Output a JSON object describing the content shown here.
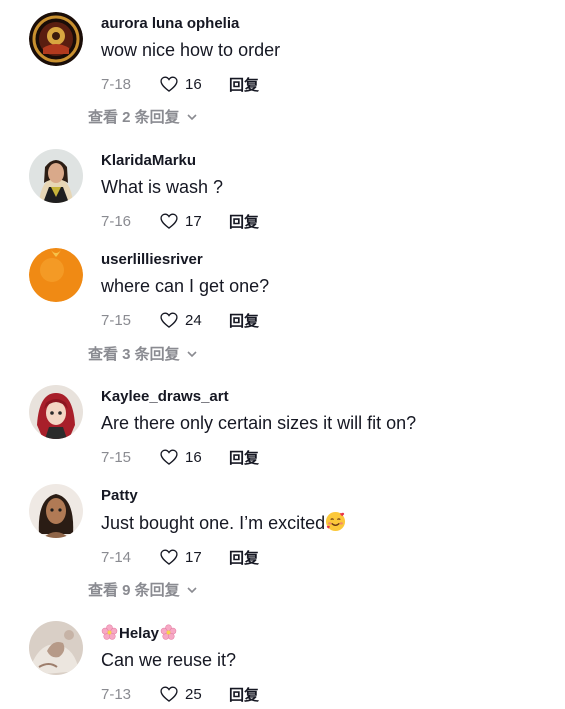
{
  "comments": [
    {
      "username": "aurora luna ophelia",
      "text": "wow nice how to order",
      "date": "7-18",
      "likes": "16",
      "reply": "回复"
    },
    {
      "username": "KlaridaMarku",
      "text": "What is wash ?",
      "date": "7-16",
      "likes": "17",
      "reply": "回复"
    },
    {
      "username": "userlilliesriver",
      "text": "where can I get one?",
      "date": "7-15",
      "likes": "24",
      "reply": "回复"
    },
    {
      "username": "Kaylee_draws_art",
      "text": "Are there only certain sizes it will fit on?",
      "date": "7-15",
      "likes": "16",
      "reply": "回复"
    },
    {
      "username": "Patty",
      "text": "Just bought one. I’m excited",
      "date": "7-14",
      "likes": "17",
      "reply": "回复",
      "emoji": "smiling-face-with-hearts"
    },
    {
      "username": "Helay",
      "text": "Can we reuse it?",
      "date": "7-13",
      "likes": "25",
      "reply": "回复",
      "name_emoji": "cherry-blossom"
    }
  ],
  "view_more": [
    {
      "label": "查看 2 条回复"
    },
    {
      "label": "查看 3 条回复"
    },
    {
      "label": "查看 9 条回复"
    }
  ],
  "colors": {
    "text": "#161823",
    "muted": "#8a8b91",
    "background": "#ffffff"
  },
  "icons": {
    "like": "heart-outline-icon",
    "expand": "chevron-down-icon"
  }
}
